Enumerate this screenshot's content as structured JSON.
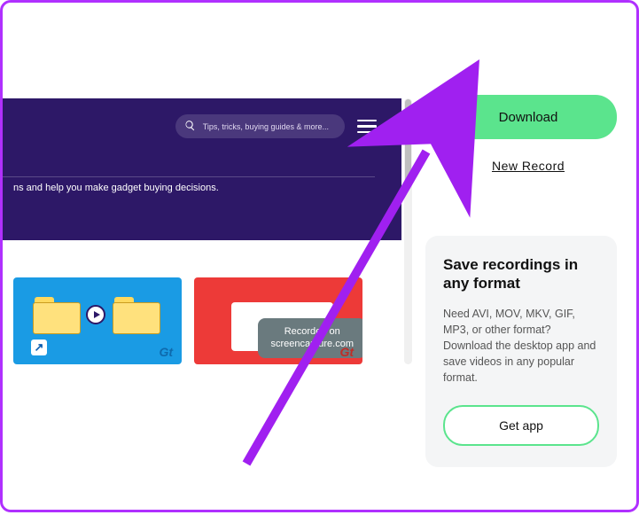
{
  "header": {
    "search_placeholder": "Tips, tricks, buying guides & more...",
    "tagline": "ns and help you make gadget buying decisions."
  },
  "thumbnails": {
    "gt_brand": "Gt",
    "recorded": {
      "line1": "Recorded on",
      "line2": "screencapture.com"
    }
  },
  "right": {
    "download_label": "Download",
    "new_record_label": "New Record"
  },
  "promo": {
    "title": "Save recordings in any format",
    "desc": "Need AVI, MOV, MKV, GIF, MP3, or other format? Download the desktop app and save videos in any popular format.",
    "cta": "Get app"
  },
  "colors": {
    "accent_green": "#5be48d",
    "header_purple": "#2d1867",
    "arrow": "#a020f0"
  }
}
